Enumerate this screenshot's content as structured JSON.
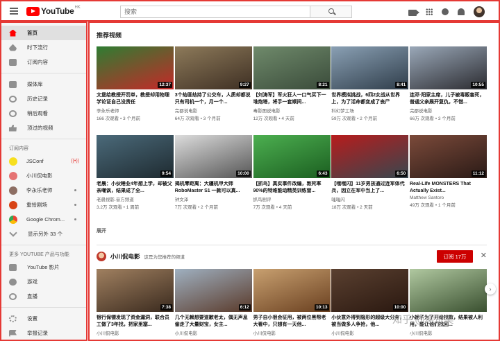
{
  "header": {
    "logo_text": "YouTube",
    "logo_region": "HK",
    "search_placeholder": "搜索"
  },
  "sidebar": {
    "main_items": [
      {
        "label": "首页",
        "icon": "home-icon",
        "active": true
      },
      {
        "label": "时下流行",
        "icon": "trending-icon"
      },
      {
        "label": "订阅内容",
        "icon": "subscriptions-icon"
      }
    ],
    "library_items": [
      {
        "label": "媒体库",
        "icon": "library-icon"
      },
      {
        "label": "历史记录",
        "icon": "history-icon"
      },
      {
        "label": "稍后观看",
        "icon": "watch-later-icon"
      },
      {
        "label": "顶过的视频",
        "icon": "liked-icon"
      }
    ],
    "subs_heading": "订阅内容",
    "subscriptions": [
      {
        "label": "JSConf",
        "color": "#f7df1e",
        "badge": "live"
      },
      {
        "label": "小川侃电影",
        "color": "#e57373"
      },
      {
        "label": "李永乐老师",
        "color": "#8d6e63",
        "badge": "dot"
      },
      {
        "label": "重拾剧场",
        "color": "#d84315",
        "badge": "dot"
      },
      {
        "label": "Google Chrom...",
        "color": "#4285f4",
        "badge": "dot"
      }
    ],
    "show_more": "显示另外 33 个",
    "more_heading": "更多 YOUTUBE 产品与功能",
    "more_items": [
      {
        "label": "YouTube 影片",
        "icon": "movies-icon"
      },
      {
        "label": "游戏",
        "icon": "gaming-icon"
      },
      {
        "label": "直播",
        "icon": "live-icon"
      }
    ],
    "bottom_items": [
      {
        "label": "设置",
        "icon": "settings-icon"
      },
      {
        "label": "举报记录",
        "icon": "flag-icon"
      }
    ]
  },
  "main": {
    "section_title": "推荐视频",
    "row1": [
      {
        "title": "文堡给教授开罚单，教授却用物理学论证自己没责任",
        "channel": "李永乐老师",
        "meta": "166 次观看 • 3 个月前",
        "duration": "12:37",
        "colors": [
          "#2e7d32",
          "#c62828"
        ]
      },
      {
        "title": "3个劫匪劫持了公交车，人质却都说只有司机一个，月一个...",
        "channel": "完郡说电影",
        "meta": "64万 次观看 • 3 个月前",
        "duration": "9:27",
        "colors": [
          "#8d7a5a",
          "#3e2f23"
        ]
      },
      {
        "title": "【刘涛军】军火狂人一口气买下一堆炮塔，将手一套顺间...",
        "channel": "毒影图说电影",
        "meta": "12万 次观看 • 4 天前",
        "duration": "8:21",
        "colors": [
          "#6f8a6b",
          "#3a4b3a"
        ]
      },
      {
        "title": "世界模拟挑战，6四2女战从世界上，为了活命都变成了丧尸",
        "channel": "科幻梦工场",
        "meta": "59万 次观看 • 2 个月前",
        "duration": "8:41",
        "colors": [
          "#8aa0b4",
          "#2f3d4a"
        ]
      },
      {
        "title": "连邓·阳家主席，儿子被毒贩害死，普通父亲展开复仇，不惜...",
        "channel": "完郡说电影",
        "meta": "66万 次观看 • 3 个月前",
        "duration": "10:55",
        "colors": [
          "#9aa8b8",
          "#2b2b30"
        ]
      }
    ],
    "row2": [
      {
        "title": "老晨：小伙睡业4年想上学，却被父亲嘲讽，结果成了全...",
        "channel": "老晨视影.音方频道",
        "meta": "3.2万 次观看 • 1 周前",
        "duration": "9:54",
        "colors": [
          "#4b6a7a",
          "#1e2a30"
        ]
      },
      {
        "title": "揭机零距离：大疆机甲大师RoboMaster S1 一款可以真...",
        "channel": "钟文泽",
        "meta": "7万 次观看 • 2 个月前",
        "duration": "10:00",
        "colors": [
          "#dcdcdc",
          "#555555"
        ]
      },
      {
        "title": "【抓鸟】真实事件改编，敦死率90%的特难能动精英训练营...",
        "channel": "抓鸟剧评",
        "meta": "7万 次观看 • 4 天前",
        "duration": "6:43",
        "colors": [
          "#4caf50",
          "#1b5e20"
        ]
      },
      {
        "title": "【嗤嗤闪】11岁男孩通过连军体代兵，因立在军中当上了...",
        "channel": "嗤嗤闪",
        "meta": "18万 次观看 • 2 天前",
        "duration": "6:50",
        "colors": [
          "#b71c1c",
          "#37474f"
        ]
      },
      {
        "title": "Real-Life MONSTERS That Actually Exist...",
        "channel": "Matthew Santoro",
        "meta": "49万 次观看 • 1 个月前",
        "duration": "11:12",
        "colors": [
          "#7b4a3a",
          "#2a1a16"
        ]
      }
    ],
    "expand_label": "展开",
    "channel": {
      "name": "小川侃电影",
      "subtitle": "这是为您推荐的频道",
      "subscribe": "订阅 17万"
    },
    "row3": [
      {
        "title": "银行保镖发现了资金漏洞，联合员工做了3年找，把家里塞...",
        "channel": "小川侃电影",
        "duration": "7:38",
        "colors": [
          "#a08060",
          "#3a2a1e"
        ]
      },
      {
        "title": "几个无赖想要道歉老太，偶无声息偷走了大量财宝，女主...",
        "channel": "小川侃电影",
        "duration": "6:12",
        "colors": [
          "#9fb0c0",
          "#5a3a2a"
        ]
      },
      {
        "title": "男子自小很会征用，被两位黑帮老大看中，只想有一天他...",
        "channel": "小川侃电影",
        "duration": "10:13",
        "colors": [
          "#c8a070",
          "#6a4020"
        ]
      },
      {
        "title": "小伙意外得到隐形的超级大分身，被当做多人争抢，他...",
        "channel": "小川侃电影",
        "duration": "10:00",
        "colors": [
          "#5a4030",
          "#2a1810"
        ]
      },
      {
        "title": "小妮子为了开给找数，结果被人利用，能让他们找回...",
        "channel": "小川侃电影",
        "duration": "",
        "colors": [
          "#b0c8a0",
          "#3a5030"
        ]
      }
    ]
  },
  "watermark": "知乎 @谢赞昊"
}
